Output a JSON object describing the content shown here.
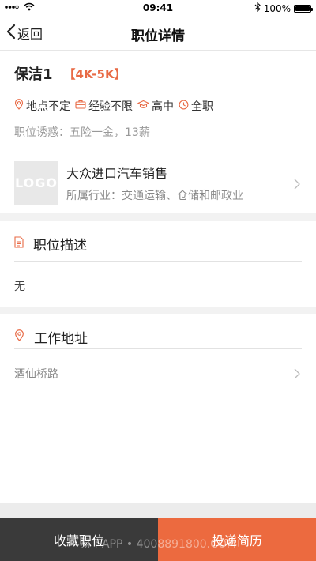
{
  "status_bar": {
    "time": "09:41",
    "battery": "100%"
  },
  "nav": {
    "back_label": "返回",
    "title": "职位详情"
  },
  "job": {
    "title": "保洁1",
    "salary": "【4K-5K】",
    "tags": [
      {
        "icon": "location-icon",
        "label": "地点不定"
      },
      {
        "icon": "briefcase-icon",
        "label": "经验不限"
      },
      {
        "icon": "graduation-cap-icon",
        "label": "高中"
      },
      {
        "icon": "clock-icon",
        "label": "全职"
      }
    ],
    "benefits": "职位诱惑：五险一金，13薪"
  },
  "company": {
    "logo_text": "LOGO",
    "name": "大众进口汽车销售",
    "industry": "所属行业：交通运输、仓储和邮政业"
  },
  "description": {
    "heading": "职位描述",
    "content": "无"
  },
  "address": {
    "heading": "工作地址",
    "content": "酒仙桥路"
  },
  "actions": {
    "favorite_label": "收藏职位",
    "apply_label": "投递简历"
  },
  "watermark": "易下APP • 4008891800.COM",
  "colors": {
    "accent": "#e86a45",
    "apply_button": "#ec6a3f",
    "favorite_button": "#3a3a3a"
  }
}
